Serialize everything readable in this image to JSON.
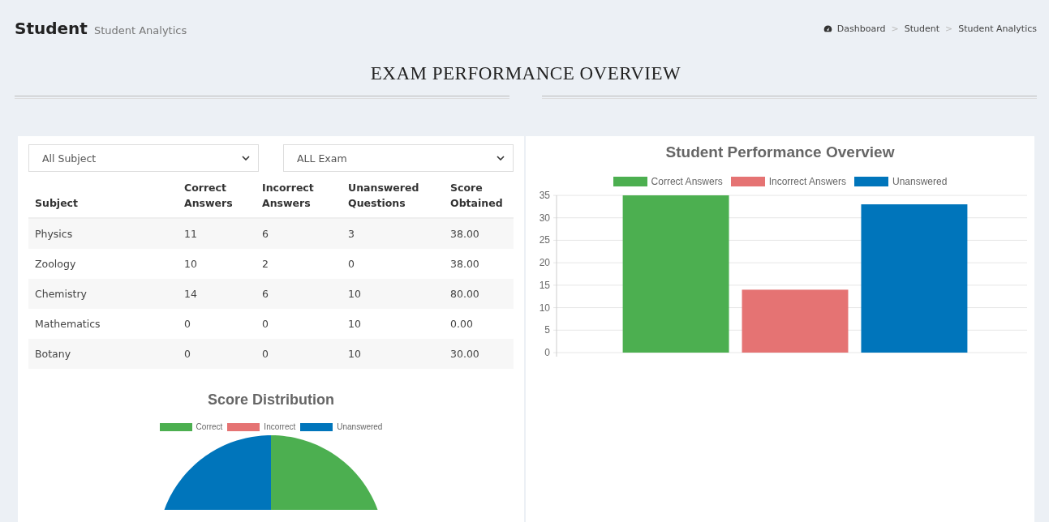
{
  "header": {
    "title": "Student",
    "subtitle": "Student Analytics"
  },
  "breadcrumb": [
    {
      "label": "Dashboard",
      "icon": true
    },
    {
      "separator": ">",
      "label": "Student"
    },
    {
      "separator": ">",
      "label": "Student Analytics"
    }
  ],
  "section_title": "EXAM PERFORMANCE OVERVIEW",
  "filters": [
    {
      "value": "All Subject"
    },
    {
      "value": "ALL Exam"
    }
  ],
  "table": {
    "columns": [
      "Subject",
      "Correct Answers",
      "Incorrect Answers",
      "Unanswered Questions",
      "Score Obtained"
    ],
    "rows": [
      [
        "Physics",
        "11",
        "6",
        "3",
        "38.00"
      ],
      [
        "Zoology",
        "10",
        "2",
        "0",
        "38.00"
      ],
      [
        "Chemistry",
        "14",
        "6",
        "10",
        "80.00"
      ],
      [
        "Mathematics",
        "0",
        "0",
        "10",
        "0.00"
      ],
      [
        "Botany",
        "0",
        "0",
        "10",
        "30.00"
      ]
    ]
  },
  "pie": {
    "title": "Score Distribution",
    "legend": [
      {
        "label": "Correct",
        "color": "#4caf50"
      },
      {
        "label": "Incorrect",
        "color": "#e57373"
      },
      {
        "label": "Unanswered",
        "color": "#0075bb"
      }
    ]
  },
  "bar_chart": {
    "chart_data": {
      "type": "bar",
      "grid": true,
      "title": "Student Performance Overview",
      "ylim": [
        0,
        35
      ],
      "yticks": [
        0,
        5,
        10,
        15,
        20,
        25,
        30,
        35
      ],
      "series": [
        {
          "name": "Correct Answers",
          "color": "#4caf50",
          "values": [
            35
          ]
        },
        {
          "name": "Incorrect Answers",
          "color": "#e57373",
          "values": [
            14
          ]
        },
        {
          "name": "Unanswered",
          "color": "#0075bb",
          "values": [
            33
          ]
        }
      ]
    }
  }
}
